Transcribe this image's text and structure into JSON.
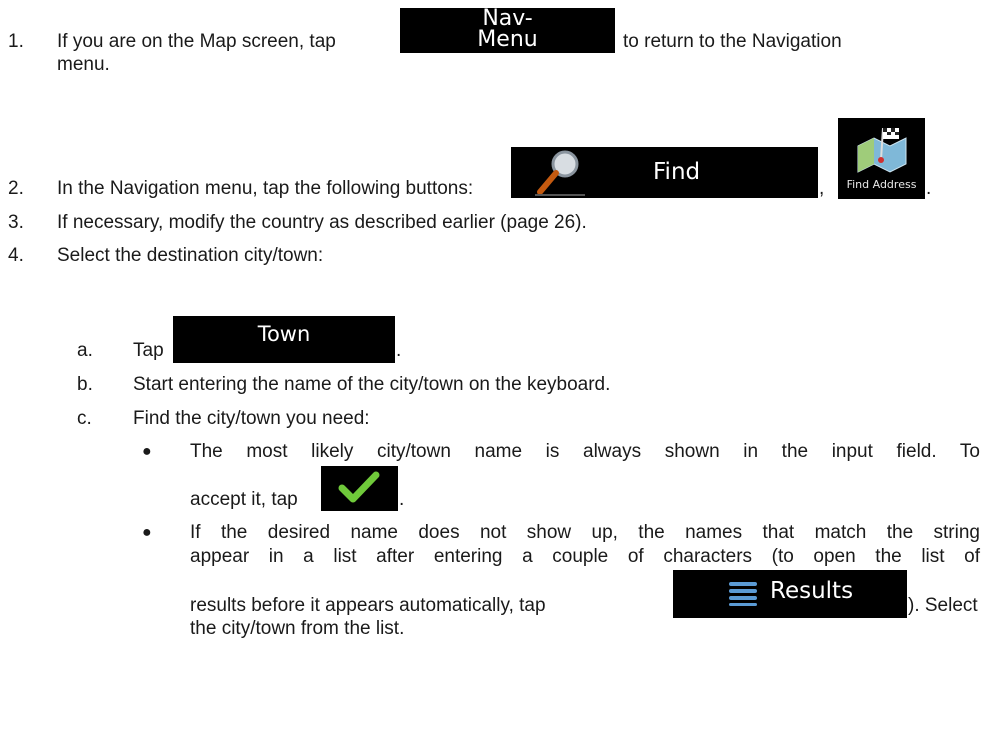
{
  "steps": [
    {
      "num": "1.",
      "text_before": "If you are on the Map screen, tap",
      "text_after": "to return to the Navigation",
      "text_line2": "menu."
    },
    {
      "num": "2.",
      "text": "In the Navigation menu, tap the following buttons:"
    },
    {
      "num": "3.",
      "text": "If necessary, modify the country as described earlier (page 26)."
    },
    {
      "num": "4.",
      "text": "Select the destination city/town:"
    }
  ],
  "substeps": [
    {
      "letter": "a.",
      "text": "Tap"
    },
    {
      "letter": "b.",
      "text": "Start entering the name of the city/town on the keyboard."
    },
    {
      "letter": "c.",
      "text": "Find the city/town you need:"
    }
  ],
  "bullets": [
    {
      "line1": "The most likely city/town name is always shown in the input field. To",
      "line2": "accept it, tap"
    },
    {
      "line1": "If the desired name does not show up, the names that match the string",
      "line2": "appear in a list after entering a couple of characters (to open the list of",
      "line3": "results before it appears automatically, tap",
      "after_button": "). Select",
      "line4": "the city/town from the list."
    }
  ],
  "buttons": {
    "navmenu": {
      "line1": "Nav-",
      "line2": "Menu"
    },
    "find": {
      "label": "Find",
      "icon": "magnifier-icon"
    },
    "find_address": {
      "label": "Find Address",
      "icon": "map-flag-icon"
    },
    "town": {
      "label": "Town"
    },
    "accept": {
      "icon": "checkmark-icon"
    },
    "results": {
      "label": "Results",
      "icon": "list-icon"
    }
  },
  "punct": {
    "comma": ",",
    "period": "."
  }
}
